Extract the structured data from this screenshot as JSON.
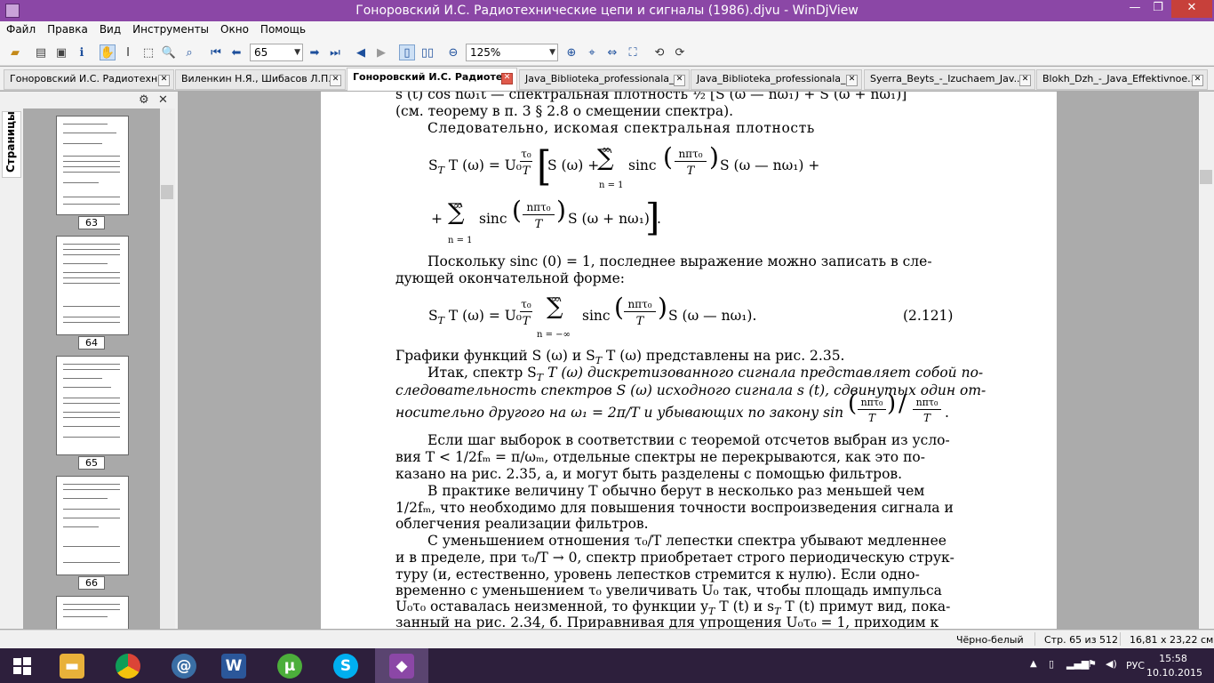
{
  "window": {
    "title": "Гоноровский И.С. Радиотехнические цепи и сигналы (1986).djvu - WinDjView"
  },
  "menu": [
    "Файл",
    "Правка",
    "Вид",
    "Инструменты",
    "Окно",
    "Помощь"
  ],
  "toolbar": {
    "page_value": "65",
    "zoom_value": "125%"
  },
  "tabs": [
    {
      "label": "Гоноровский И.С. Радиотехн..."
    },
    {
      "label": "Виленкин Н.Я., Шибасов Л.П...."
    },
    {
      "label": "Гоноровский И.С. Радиоте...",
      "active": true
    },
    {
      "label": "Java_Biblioteka_professionala_..."
    },
    {
      "label": "Java_Biblioteka_professionala_..."
    },
    {
      "label": "Syerra_Beyts_-_Izuchaem_Jav..."
    },
    {
      "label": "Blokh_Dzh_-_Java_Effektivnoe..."
    }
  ],
  "sidebar": {
    "tab_label": "Страницы",
    "pages": [
      "63",
      "64",
      "65",
      "66"
    ]
  },
  "doc": {
    "l1": "s (t) cos nω₁t — спектральная плотность ½ [S (ω — nω₁) + S (ω + nω₁)]",
    "l2": "(см. теорему в п. 3 § 2.8 о смещении спектра).",
    "l3": "Следовательно, искомая спектральная плотность",
    "f1a": "S",
    "f1b": "T (ω) = U₀",
    "f1c": "S (ω) +",
    "f1d": "sinc",
    "f1e": "S (ω — nω₁) +",
    "f2a": "+",
    "f2b": "sinc",
    "f2c": "S (ω + nω₁)",
    "sum_inf": "∞",
    "sum_lo": "n = 1",
    "frac_num": "τ₀",
    "frac_den": "T",
    "frac2_num": "nπτ₀",
    "frac2_den": "T",
    "l4": "Поскольку sinc (0) = 1, последнее выражение можно записать в сле-",
    "l5": "дующей окончательной форме:",
    "f3b": "sinc",
    "f3c": "S (ω — nω₁).",
    "eqnum": "(2.121)",
    "f3lo": "n = −∞",
    "l6": "Графики функций S (ω) и S",
    "l6b": "T (ω) представлены на рис. 2.35.",
    "l7": "Итак, спектр S",
    "l7b": "T (ω) дискретизованного сигнала представляет собой по-",
    "l8": "следовательность спектров S (ω) исходного сигнала s (t), сдвинутых один от-",
    "l9": "носительно другого на ω₁ = 2π/T и убывающих по закону sin",
    "l9b": ".",
    "l10": "Если шаг выборок в соответствии с теоремой отсчетов выбран из усло-",
    "l11": "вия T < 1/2fₘ = π/ωₘ, отдельные спектры не перекрываются, как это по-",
    "l12": "казано на рис. 2.35, а, и могут быть разделены с помощью фильтров.",
    "l13": "В практике величину T обычно берут в несколько раз меньшей чем",
    "l14": "1/2fₘ, что необходимо для повышения точности воспроизведения сигнала и",
    "l15": "облегчения реализации фильтров.",
    "l16": "С уменьшением отношения τ₀/T лепестки спектра убывают медленнее",
    "l17": "и в пределе, при τ₀/T → 0, спектр приобретает строго периодическую струк-",
    "l18": "туру (и, естественно, уровень лепестков стремится к нулю). Если одно-",
    "l19": "временно с уменьшением τ₀ увеличивать U₀ так, чтобы площадь импульса",
    "l20": "U₀τ₀ оставалась неизменной, то функции y",
    "l20b": "T (t) и s",
    "l20c": "T (t) примут вид, пока-",
    "l21": "занный на рис. 2.34, б. Приравнивая для упрощения U₀τ₀ = 1, приходим к"
  },
  "status": {
    "mode": "Чёрно-белый",
    "page": "Стр. 65 из 512",
    "size": "16,81 x 23,22 см"
  },
  "tray": {
    "lang": "РУС",
    "time": "15:58",
    "date": "10.10.2015"
  }
}
